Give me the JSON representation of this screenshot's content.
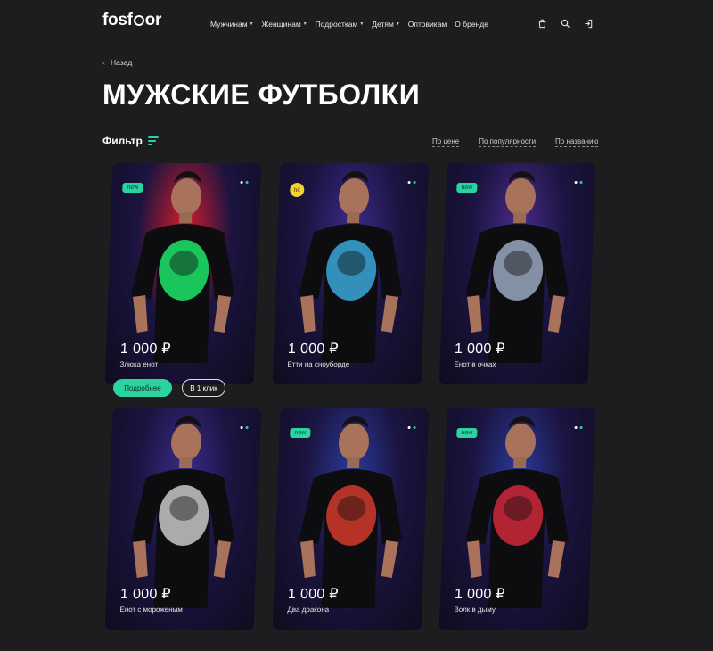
{
  "header": {
    "logo": {
      "text_before": "fosf",
      "text_after": "or"
    },
    "nav": [
      {
        "label": "Мужчинам",
        "has_caret": true
      },
      {
        "label": "Женщинам",
        "has_caret": true
      },
      {
        "label": "Подросткам",
        "has_caret": true
      },
      {
        "label": "Детям",
        "has_caret": true
      },
      {
        "label": "Оптовикам",
        "has_caret": false
      },
      {
        "label": "О бренде",
        "has_caret": false
      }
    ],
    "icons": [
      "bag-icon",
      "search-icon",
      "login-icon"
    ]
  },
  "back_label": "Назад",
  "page_title": "МУЖСКИЕ ФУТБОЛКИ",
  "filter_label": "Фильтр",
  "sort_options": [
    "По цене",
    "По популярности",
    "По названию"
  ],
  "products": [
    {
      "price": "1 000 ₽",
      "name": "Злюка енот",
      "badge": "new",
      "accent": "#1de86a",
      "glow": "#d41c2c"
    },
    {
      "price": "1 000 ₽",
      "name": "Етти на сноуборде",
      "badge": "hit",
      "accent": "#3aa8d8",
      "glow": "#3b2a8a"
    },
    {
      "price": "1 000 ₽",
      "name": "Енот в очках",
      "badge": "new",
      "accent": "#9aa8c0",
      "glow": "#4a2a8a"
    },
    {
      "price": "1 000 ₽",
      "name": "Енот с мороженым",
      "badge": "",
      "accent": "#c8c8c8",
      "glow": "#3b2a8a"
    },
    {
      "price": "1 000 ₽",
      "name": "Два дракона",
      "badge": "new",
      "accent": "#d23a2a",
      "glow": "#2a3a9a"
    },
    {
      "price": "1 000 ₽",
      "name": "Волк в дыму",
      "badge": "new",
      "accent": "#d0283a",
      "glow": "#2a3a9a"
    }
  ],
  "buttons": {
    "more": "Подробнее",
    "one_click": "В 1 клик"
  }
}
